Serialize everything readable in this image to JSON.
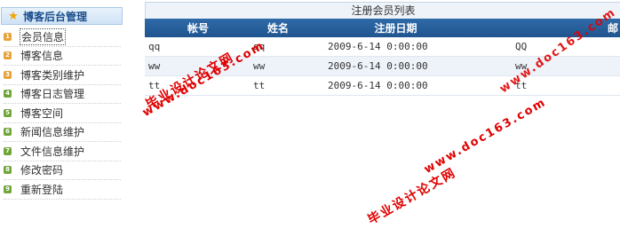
{
  "sidebar": {
    "title": "博客后台管理",
    "items": [
      {
        "num": "1",
        "label": "会员信息",
        "color": "#e7a33a"
      },
      {
        "num": "2",
        "label": "博客信息",
        "color": "#e7a33a"
      },
      {
        "num": "3",
        "label": "博客类别维护",
        "color": "#e7a33a"
      },
      {
        "num": "4",
        "label": "博客日志管理",
        "color": "#6fa63a"
      },
      {
        "num": "5",
        "label": "博客空间",
        "color": "#6fa63a"
      },
      {
        "num": "6",
        "label": "新闻信息维护",
        "color": "#6fa63a"
      },
      {
        "num": "7",
        "label": "文件信息维护",
        "color": "#6fa63a"
      },
      {
        "num": "8",
        "label": "修改密码",
        "color": "#6fa63a"
      },
      {
        "num": "9",
        "label": "重新登陆",
        "color": "#6fa63a"
      }
    ]
  },
  "table": {
    "title": "注册会员列表",
    "headers": [
      "帐号",
      "姓名",
      "注册日期",
      "邮"
    ],
    "rows": [
      [
        "qq",
        "qq",
        "2009-6-14 0:00:00",
        "QQ"
      ],
      [
        "ww",
        "ww",
        "2009-6-14 0:00:00",
        "ww"
      ],
      [
        "tt",
        "tt",
        "2009-6-14 0:00:00",
        "tt"
      ]
    ]
  },
  "watermarks": {
    "line1": "毕业设计论文网",
    "line2": "www.doc163.com"
  },
  "colors": {
    "header_bg": "#2a62a0",
    "watermark": "#e00000",
    "accent": "#1a4e8c"
  }
}
